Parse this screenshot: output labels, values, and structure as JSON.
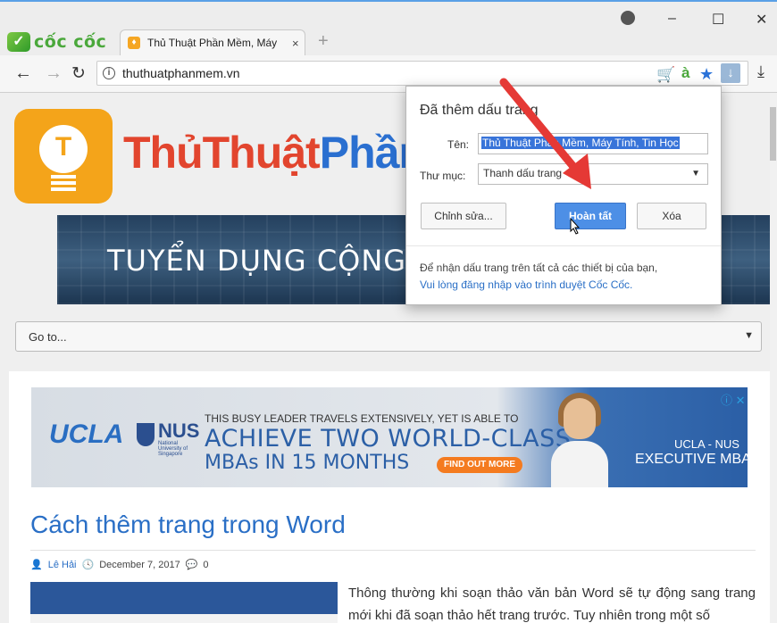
{
  "browser": {
    "brand": "cốc cốc",
    "tab_title": "Thủ Thuật Phần Mềm, Máy",
    "new_tab": "+",
    "tab_close": "×",
    "url": "thuthuatphanmem.vn",
    "window": {
      "minimize": "–",
      "maximize": "☐",
      "close": "✕"
    }
  },
  "site": {
    "name_part1": "ThủThuật",
    "name_part2": "Phần",
    "banner_text": "TUYỂN DỤNG CỘNG",
    "goto_label": "Go to..."
  },
  "ad": {
    "brand1": "UCLA",
    "brand2": "NUS",
    "brand2_sub": "National University of Singapore",
    "line1": "THIS BUSY LEADER TRAVELS EXTENSIVELY, YET IS ABLE TO",
    "line2": "ACHIEVE TWO WORLD-CLASS",
    "line3": "MBAs IN 15 MONTHS",
    "cta": "FIND OUT MORE",
    "program1": "UCLA - NUS",
    "program2": "EXECUTIVE MBA",
    "adchoices": "ⓘ ✕"
  },
  "article": {
    "title": "Cách thêm trang trong Word",
    "author": "Lê Hải",
    "date": "December 7, 2017",
    "comments": "0",
    "paragraph": "Thông thường khi soạn thảo văn bản Word sẽ tự động sang trang mới khi đã soạn thảo hết trang trước. Tuy nhiên trong một số"
  },
  "popup": {
    "title": "Đã thêm dấu trang",
    "name_label": "Tên:",
    "name_value": "Thủ Thuật Phần Mềm, Máy Tính, Tin Học",
    "folder_label": "Thư mục:",
    "folder_value": "Thanh dấu trang",
    "edit_button": "Chỉnh sửa...",
    "done_button": "Hoàn tất",
    "delete_button": "Xóa",
    "sync_text": "Để nhận dấu trang trên tất cả các thiết bị của bạn,",
    "sync_link": "Vui lòng đăng nhập vào trình duyệt Cốc Cốc."
  },
  "colors": {
    "accent": "#2a6fc6",
    "brand_green": "#4aa83b",
    "arrow_red": "#e53935"
  }
}
